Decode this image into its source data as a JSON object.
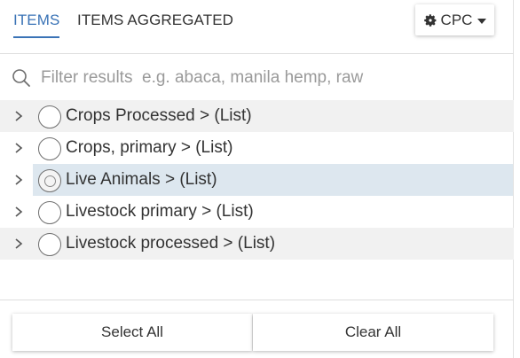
{
  "tabs": [
    {
      "label": "ITEMS",
      "active": true
    },
    {
      "label": "ITEMS AGGREGATED",
      "active": false
    }
  ],
  "code_selector": {
    "label": "CPC",
    "icon": "gear-icon"
  },
  "search": {
    "placeholder": "Filter results  e.g. abaca, manila hemp, raw",
    "value": "",
    "icon": "search-icon"
  },
  "tree": {
    "items": [
      {
        "label": "Crops Processed > (List)",
        "selected": false,
        "shaded": true
      },
      {
        "label": "Crops, primary > (List)",
        "selected": false,
        "shaded": false
      },
      {
        "label": "Live Animals > (List)",
        "selected": true,
        "shaded": false
      },
      {
        "label": "Livestock primary > (List)",
        "selected": false,
        "shaded": false
      },
      {
        "label": "Livestock processed > (List)",
        "selected": false,
        "shaded": true
      }
    ]
  },
  "actions": {
    "select_all_label": "Select All",
    "clear_all_label": "Clear All"
  },
  "colors": {
    "accent": "#3a73b6",
    "selected_row_bg": "#dde7ef",
    "shaded_row_bg": "#f1f1f1"
  }
}
